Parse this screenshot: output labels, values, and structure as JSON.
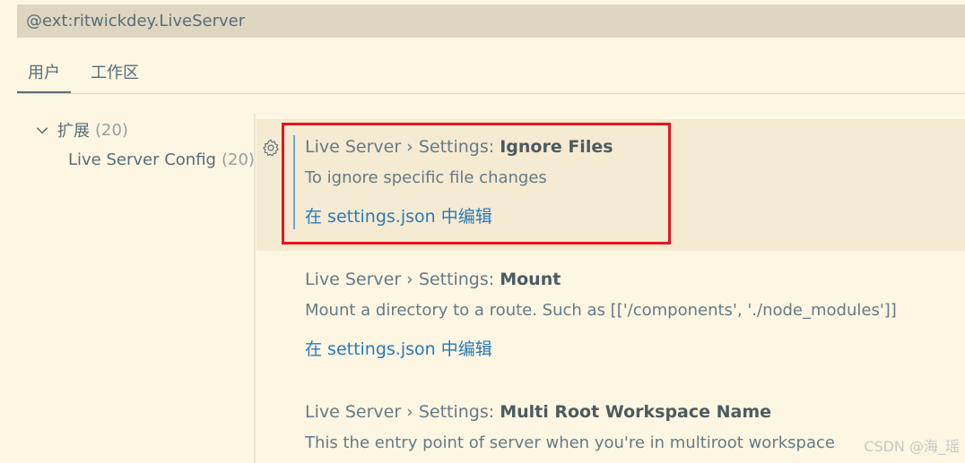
{
  "search": {
    "value": "@ext:ritwickdey.LiveServer"
  },
  "tabs": [
    {
      "label": "用户"
    },
    {
      "label": "工作区"
    }
  ],
  "toc": {
    "group": {
      "label": "扩展",
      "count": "(20)"
    },
    "child": {
      "label": "Live Server Config",
      "count": "(20)"
    }
  },
  "settings": [
    {
      "category": "Live Server › Settings: ",
      "name": "Ignore Files",
      "description": "To ignore specific file changes",
      "link": "在 settings.json 中编辑"
    },
    {
      "category": "Live Server › Settings: ",
      "name": "Mount",
      "description": "Mount a directory to a route. Such as [['/components', './node_modules']]",
      "link": "在 settings.json 中编辑"
    },
    {
      "category": "Live Server › Settings: ",
      "name": "Multi Root Workspace Name",
      "description": "This the entry point of server when you're in multiroot workspace"
    }
  ],
  "watermark": "CSDN @海_瑶",
  "colors": {
    "background": "#fdf6e3",
    "link": "#2a7ab8",
    "annotation_box": "#e8131d",
    "focused_row": "#f5ead2"
  }
}
